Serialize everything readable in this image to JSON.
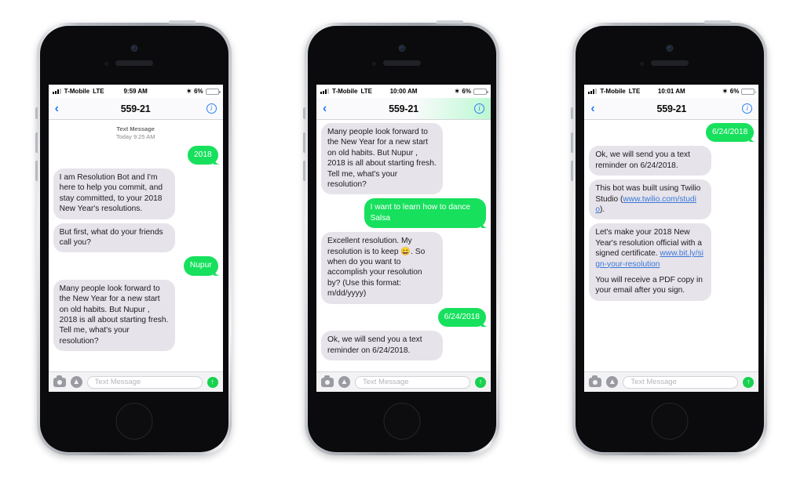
{
  "scene": {
    "background_color": "#ffffff",
    "phone_count": 3,
    "accent_green": "#17e05d",
    "incoming_bubble_color": "#e6e3ea",
    "link_color": "#3b78d8",
    "tint_blue": "#2a7df7"
  },
  "input_bar": {
    "camera_icon": "camera-icon",
    "appstore_icon": "app-store-icon",
    "placeholder": "Text Message",
    "send_icon": "↑"
  },
  "phones": [
    {
      "id": "phone-1",
      "status": {
        "carrier": "T-Mobile",
        "network": "LTE",
        "time": "9:59 AM",
        "bluetooth": "✶",
        "battery": "6%"
      },
      "nav": {
        "back": "‹",
        "title": "559-21",
        "info": "i",
        "tinted": false
      },
      "timestamp": {
        "label": "Text Message",
        "detail": "Today 9:25 AM"
      },
      "messages": [
        {
          "side": "out",
          "text": "2018"
        },
        {
          "side": "in",
          "text": "I am Resolution Bot and I'm here to help you commit, and stay committed, to your 2018 New Year's resolutions."
        },
        {
          "side": "in",
          "text": "But first, what do your friends call you?"
        },
        {
          "side": "out",
          "text": "Nupur"
        },
        {
          "side": "in",
          "text": "Many people look forward to the New Year for a new start on old habits. But Nupur , 2018 is all about starting fresh. Tell me, what's your resolution?",
          "clipped_bottom": true
        }
      ]
    },
    {
      "id": "phone-2",
      "status": {
        "carrier": "T-Mobile",
        "network": "LTE",
        "time": "10:00 AM",
        "bluetooth": "✶",
        "battery": "6%"
      },
      "nav": {
        "back": "‹",
        "title": "559-21",
        "info": "i",
        "tinted": true
      },
      "messages": [
        {
          "side": "in",
          "text": "Many people look forward to the New Year for a new start on old habits. But Nupur , 2018 is all about starting fresh. Tell me, what's your resolution?"
        },
        {
          "side": "out",
          "text": "I want to learn how to dance Salsa"
        },
        {
          "side": "in",
          "text": "Excellent resolution. My resolution is to keep 😄. So when do you want to accomplish your resolution by? (Use this format: m/dd/yyyy)"
        },
        {
          "side": "out",
          "text": "6/24/2018"
        },
        {
          "side": "in",
          "text": "Ok, we will send you a text reminder on 6/24/2018.",
          "clipped_bottom": true
        }
      ]
    },
    {
      "id": "phone-3",
      "status": {
        "carrier": "T-Mobile",
        "network": "LTE",
        "time": "10:01 AM",
        "bluetooth": "✶",
        "battery": "6%"
      },
      "nav": {
        "back": "‹",
        "title": "559-21",
        "info": "i",
        "tinted": false
      },
      "messages": [
        {
          "side": "out",
          "text": "6/24/2018"
        },
        {
          "side": "in",
          "text": "Ok, we will send you a text reminder on 6/24/2018."
        },
        {
          "side": "in",
          "rich": [
            {
              "t": "text",
              "v": "This bot was built using Twilio Studio ("
            },
            {
              "t": "link",
              "v": "www.twilio.com/studio"
            },
            {
              "t": "text",
              "v": ")."
            }
          ]
        },
        {
          "side": "in",
          "rich": [
            {
              "t": "text",
              "v": "Let's make your 2018 New Year's resolution official with a signed certificate. "
            },
            {
              "t": "link",
              "v": "www.bit.ly/sign-your-resolution"
            },
            {
              "t": "break",
              "v": ""
            },
            {
              "t": "text",
              "v": "You will receive a PDF copy in your email after you sign."
            }
          ],
          "clipped_bottom": true
        }
      ]
    }
  ]
}
